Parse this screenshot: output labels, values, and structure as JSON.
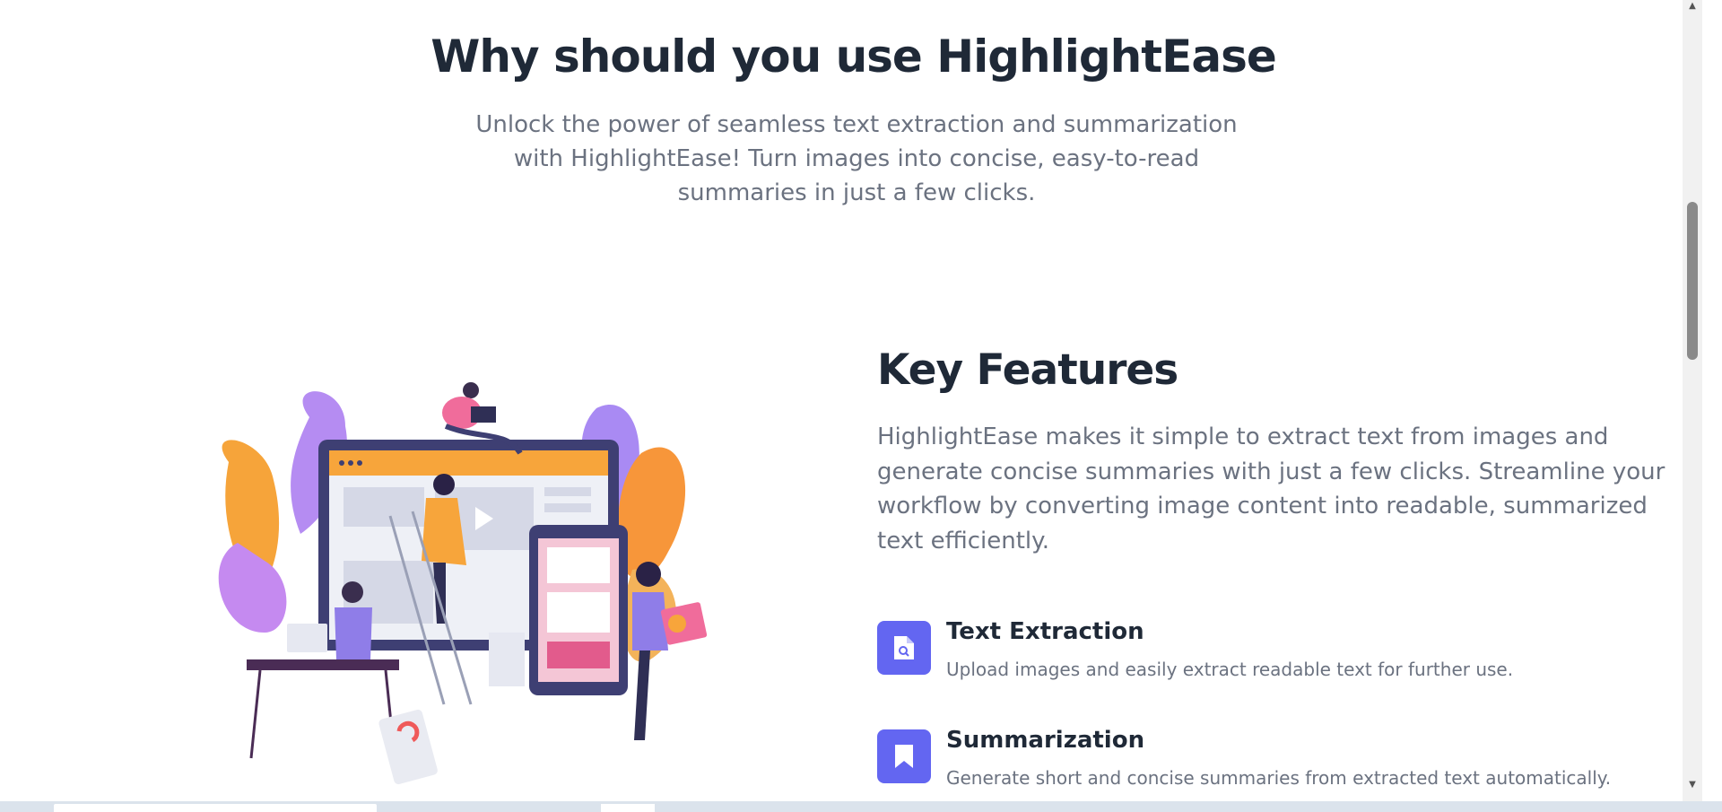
{
  "hero": {
    "title": "Why should you use HighlightEase",
    "subtitle": "Unlock the power of seamless text extraction and summarization with HighlightEase! Turn images into concise, easy-to-read summaries in just a few clicks."
  },
  "key_features": {
    "title": "Key Features",
    "description": "HighlightEase makes it simple to extract text from images and generate concise summaries with just a few clicks. Streamline your workflow by converting image content into readable, summarized text efficiently.",
    "items": [
      {
        "icon": "document-search-icon",
        "name": "Text Extraction",
        "text": "Upload images and easily extract readable text for further use."
      },
      {
        "icon": "bookmark-icon",
        "name": "Summarization",
        "text": "Generate short and concise summaries from extracted text automatically."
      }
    ]
  },
  "colors": {
    "accent": "#6366f1",
    "heading": "#1f2937",
    "body_text": "#6b7280"
  }
}
